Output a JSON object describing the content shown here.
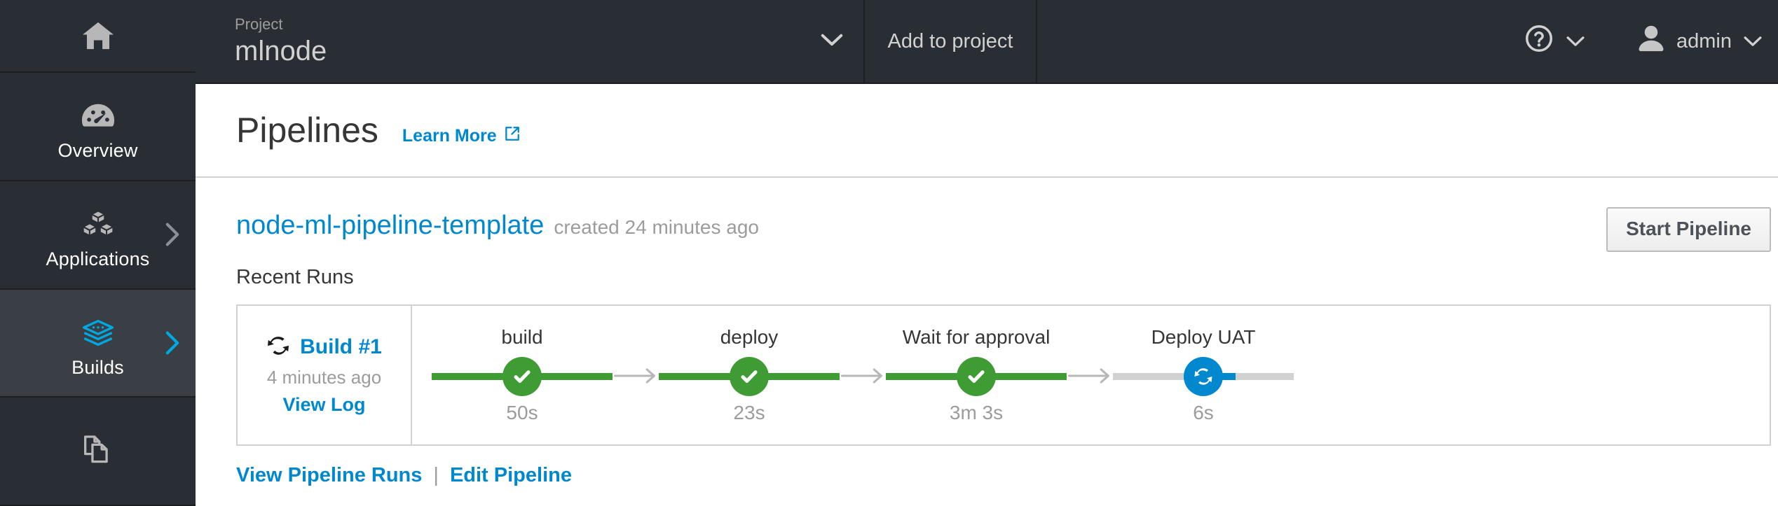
{
  "sidebar": {
    "home_icon": "home-icon",
    "items": [
      {
        "label": "Overview",
        "icon": "dashboard-gauge-icon",
        "active": false,
        "has_chevron": false
      },
      {
        "label": "Applications",
        "icon": "cubes-icon",
        "active": false,
        "has_chevron": true
      },
      {
        "label": "Builds",
        "icon": "layers-stack-icon",
        "active": true,
        "has_chevron": true
      },
      {
        "label": "",
        "icon": "documents-copy-icon",
        "active": false,
        "has_chevron": false
      }
    ]
  },
  "topbar": {
    "project_kicker": "Project",
    "project_name": "mlnode",
    "project_chevron_icon": "chevron-down-icon",
    "add_to_project": "Add to project",
    "help_icon": "question-circle-icon",
    "help_chevron_icon": "chevron-down-icon",
    "user_icon": "user-avatar-icon",
    "user_name": "admin",
    "user_chevron_icon": "chevron-down-icon"
  },
  "page": {
    "title": "Pipelines",
    "learn_more": "Learn More",
    "learn_more_icon": "external-link-icon"
  },
  "pipeline": {
    "name": "node-ml-pipeline-template",
    "created": "created 24 minutes ago",
    "start_button": "Start Pipeline",
    "recent_runs_label": "Recent Runs",
    "run": {
      "icon": "sync-rotate-icon",
      "title": "Build #1",
      "time": "4 minutes ago",
      "view_log": "View Log"
    },
    "stages": [
      {
        "name": "build",
        "duration": "50s",
        "status": "done",
        "icon": "check-circle-icon"
      },
      {
        "name": "deploy",
        "duration": "23s",
        "status": "done",
        "icon": "check-circle-icon"
      },
      {
        "name": "Wait for approval",
        "duration": "3m 3s",
        "status": "done",
        "icon": "check-circle-icon"
      },
      {
        "name": "Deploy UAT",
        "duration": "6s",
        "status": "running",
        "icon": "sync-circle-icon"
      }
    ],
    "arrow_icon": "arrow-right-icon",
    "links": {
      "view_runs": "View Pipeline Runs",
      "separator": "|",
      "edit": "Edit Pipeline"
    }
  },
  "colors": {
    "sidebar_bg": "#292e34",
    "sidebar_active_bg": "#393f44",
    "accent_blue": "#0088ce",
    "success_green": "#3f9c35",
    "muted_gray": "#9c9c9c",
    "track_gray": "#d1d1d1"
  }
}
